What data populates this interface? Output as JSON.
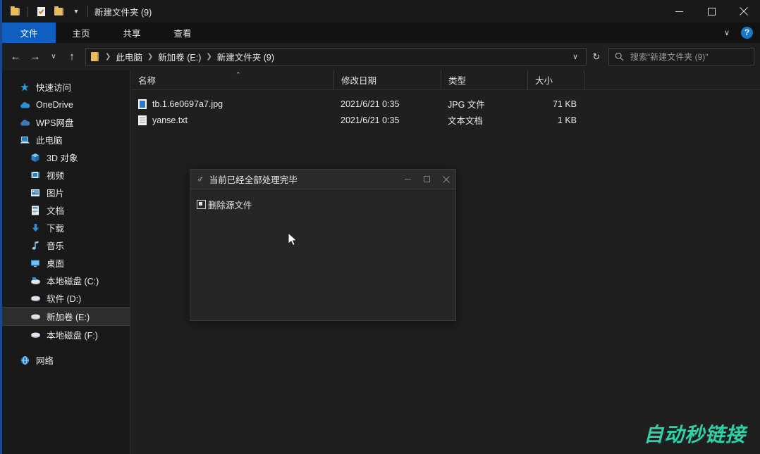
{
  "window": {
    "title": "新建文件夹 (9)",
    "accent_color": "#1b4a8f",
    "background": "#1f1f1f",
    "quick_access": [
      {
        "name": "folder-icon",
        "label": "文件夹"
      },
      {
        "name": "properties-icon",
        "label": "属性"
      },
      {
        "name": "new-folder-icon",
        "label": "新建文件夹"
      }
    ],
    "controls": {
      "minimize": "最小化",
      "maximize": "最大化",
      "close": "关闭"
    }
  },
  "ribbon": {
    "tabs": [
      {
        "label": "文件",
        "active": true
      },
      {
        "label": "主页",
        "active": false
      },
      {
        "label": "共享",
        "active": false
      },
      {
        "label": "查看",
        "active": false
      }
    ],
    "expand_label": "∨",
    "help_label": "?",
    "active_color": "#0f5ec1"
  },
  "address_bar": {
    "back": "←",
    "forward": "→",
    "recent": "∨",
    "up": "↑",
    "breadcrumb": [
      "此电脑",
      "新加卷 (E:)",
      "新建文件夹 (9)"
    ],
    "dropdown": "∨",
    "refresh": "↻"
  },
  "search": {
    "placeholder": "搜索\"新建文件夹 (9)\"",
    "icon": "search-icon"
  },
  "sidebar": {
    "items": [
      {
        "label": "快速访问",
        "icon": "star-icon",
        "level": 0,
        "selected": false
      },
      {
        "label": "OneDrive",
        "icon": "cloud-icon",
        "level": 0,
        "selected": false
      },
      {
        "label": "WPS网盘",
        "icon": "cloud-icon",
        "level": 0,
        "selected": false
      },
      {
        "label": "此电脑",
        "icon": "computer-icon",
        "level": 0,
        "selected": false
      },
      {
        "label": "3D 对象",
        "icon": "3d-object-icon",
        "level": 1,
        "selected": false
      },
      {
        "label": "视频",
        "icon": "video-icon",
        "level": 1,
        "selected": false
      },
      {
        "label": "图片",
        "icon": "pictures-icon",
        "level": 1,
        "selected": false
      },
      {
        "label": "文档",
        "icon": "documents-icon",
        "level": 1,
        "selected": false
      },
      {
        "label": "下载",
        "icon": "download-icon",
        "level": 1,
        "selected": false
      },
      {
        "label": "音乐",
        "icon": "music-icon",
        "level": 1,
        "selected": false
      },
      {
        "label": "桌面",
        "icon": "desktop-icon",
        "level": 1,
        "selected": false
      },
      {
        "label": "本地磁盘 (C:)",
        "icon": "system-drive-icon",
        "level": 1,
        "selected": false
      },
      {
        "label": "软件 (D:)",
        "icon": "drive-icon",
        "level": 1,
        "selected": false
      },
      {
        "label": "新加卷 (E:)",
        "icon": "drive-icon",
        "level": 1,
        "selected": true
      },
      {
        "label": "本地磁盘 (F:)",
        "icon": "drive-icon",
        "level": 1,
        "selected": false
      },
      {
        "label": "网络",
        "icon": "network-icon",
        "level": 0,
        "selected": false
      }
    ]
  },
  "file_list": {
    "columns": [
      {
        "label": "名称",
        "sorted": true,
        "sort_dir": "asc"
      },
      {
        "label": "修改日期",
        "sorted": false
      },
      {
        "label": "类型",
        "sorted": false
      },
      {
        "label": "大小",
        "sorted": false
      }
    ],
    "sort_caret": "⌃",
    "rows": [
      {
        "name": "tb.1.6e0697a7.jpg",
        "icon": "jpg-file-icon",
        "date": "2021/6/21 0:35",
        "type": "JPG 文件",
        "size": "71 KB"
      },
      {
        "name": "yanse.txt",
        "icon": "txt-file-icon",
        "date": "2021/6/21 0:35",
        "type": "文本文档",
        "size": "1 KB"
      }
    ]
  },
  "dialog": {
    "app_icon": "♂",
    "title": "当前已经全部处理完毕",
    "checkbox_label": "删除源文件",
    "checkbox_state": "indeterminate",
    "controls": {
      "minimize": "—",
      "maximize": "▫",
      "close": "✕"
    }
  },
  "watermark": {
    "text": "自动秒链接",
    "color": "#2fd1a8"
  }
}
